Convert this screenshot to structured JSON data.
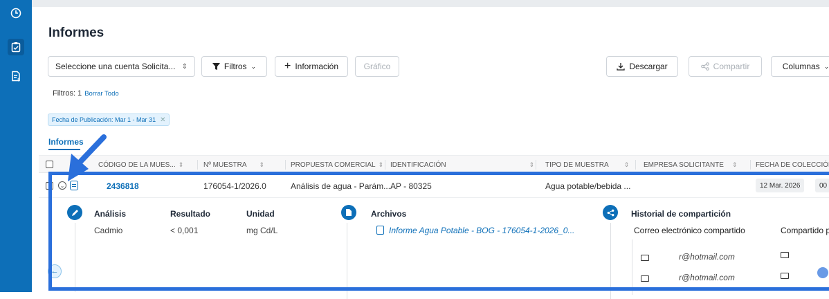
{
  "sidebar": {
    "items": [
      {
        "icon": "dashboard-icon",
        "active": false
      },
      {
        "icon": "clipboard-check-icon",
        "active": true
      },
      {
        "icon": "invoice-icon",
        "active": false
      }
    ]
  },
  "header": {
    "title": "Informes"
  },
  "toolbar": {
    "account_select": "Seleccione una cuenta Solicita...",
    "filters_label": "Filtros",
    "info_label": "Información",
    "chart_label": "Gráfico",
    "download_label": "Descargar",
    "share_label": "Compartir",
    "columns_label": "Columnas"
  },
  "filters": {
    "count_text": "Filtros: 1",
    "clear_all": "Borrar Todo",
    "chip": "Fecha de Publicación: Mar 1 - Mar 31"
  },
  "tabs": [
    {
      "label": "Informes"
    }
  ],
  "table": {
    "headers": [
      "CÓDIGO DE LA MUES...",
      "Nº MUESTRA",
      "PROPUESTA COMERCIAL",
      "IDENTIFICACIÓN",
      "TIPO DE MUESTRA",
      "EMPRESA SOLICITANTE",
      "FECHA DE COLECCIÓN"
    ],
    "rows": [
      {
        "codigo": "2436818",
        "muestra": "176054-1/2026.0",
        "propuesta": "Análisis de agua - Parám...",
        "identificacion": "AP - 80325",
        "tipo": "Agua potable/bebida ...",
        "empresa": "",
        "fecha": "12 Mar. 2026",
        "fecha_extra": "00"
      }
    ]
  },
  "detail": {
    "analysis": {
      "headers": [
        "Análisis",
        "Resultado",
        "Unidad"
      ],
      "rows": [
        {
          "analisis": "Cadmio",
          "resultado": "< 0,001",
          "unidad": "mg Cd/L"
        }
      ]
    },
    "files": {
      "title": "Archivos",
      "items": [
        "Informe Agua Potable - BOG - 176054-1-2026_0..."
      ]
    },
    "sharing": {
      "title": "Historial de compartición",
      "col_email": "Correo electrónico compartido",
      "col_by": "Compartido p",
      "rows": [
        {
          "email": "r@hotmail.com"
        },
        {
          "email": "r@hotmail.com"
        }
      ]
    }
  },
  "colors": {
    "brand": "#0d6fb8",
    "highlight": "#2a6fdb"
  }
}
